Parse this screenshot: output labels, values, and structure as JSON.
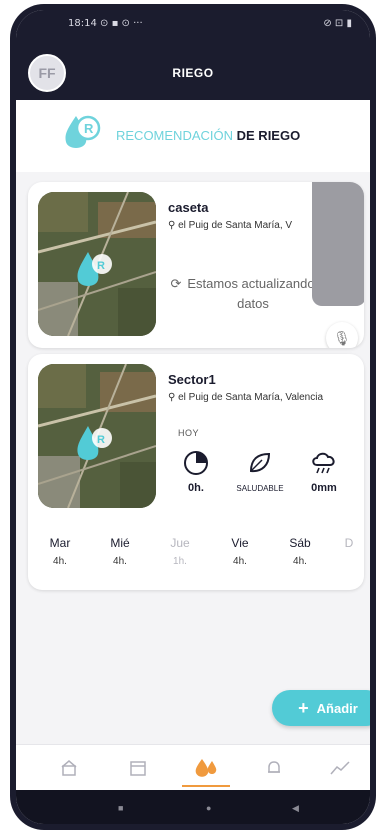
{
  "status_bar": {
    "time": "18:14",
    "left_extra": "⊙ ▪ ⊙ ···",
    "right": "⊘ ⊡ ▮"
  },
  "header": {
    "avatar_initials": "FF",
    "title": "RIEGO"
  },
  "banner": {
    "title_light": "RECOMENDACIÓN",
    "title_bold": "DE RIEGO"
  },
  "cards": [
    {
      "name": "caseta",
      "location": "el Puig de Santa María, V",
      "updating_text": "Estamos actualizando tus datos"
    },
    {
      "name": "Sector1",
      "location": "el Puig de Santa María, Valencia",
      "today_label": "HOY",
      "metrics": [
        {
          "icon": "clock-pie-icon",
          "value": "0h."
        },
        {
          "icon": "leaf-icon",
          "value": "SALUDABLE"
        },
        {
          "icon": "rain-cloud-icon",
          "value": "0mm"
        }
      ],
      "days": [
        {
          "name": "Mar",
          "value": "4h."
        },
        {
          "name": "Mié",
          "value": "4h."
        },
        {
          "name": "Jue",
          "value": "1h."
        },
        {
          "name": "Vie",
          "value": "4h."
        },
        {
          "name": "Sáb",
          "value": "4h."
        },
        {
          "name": "D",
          "value": ""
        }
      ]
    }
  ],
  "fab": {
    "label": "Añadir"
  },
  "nav": {
    "items": [
      "home-icon",
      "calendar-icon",
      "drops-icon",
      "bell-icon",
      "chart-icon"
    ],
    "active_index": 2
  },
  "colors": {
    "dark": "#1b1c2e",
    "accent": "#52cbd6",
    "active": "#f09a3e"
  }
}
